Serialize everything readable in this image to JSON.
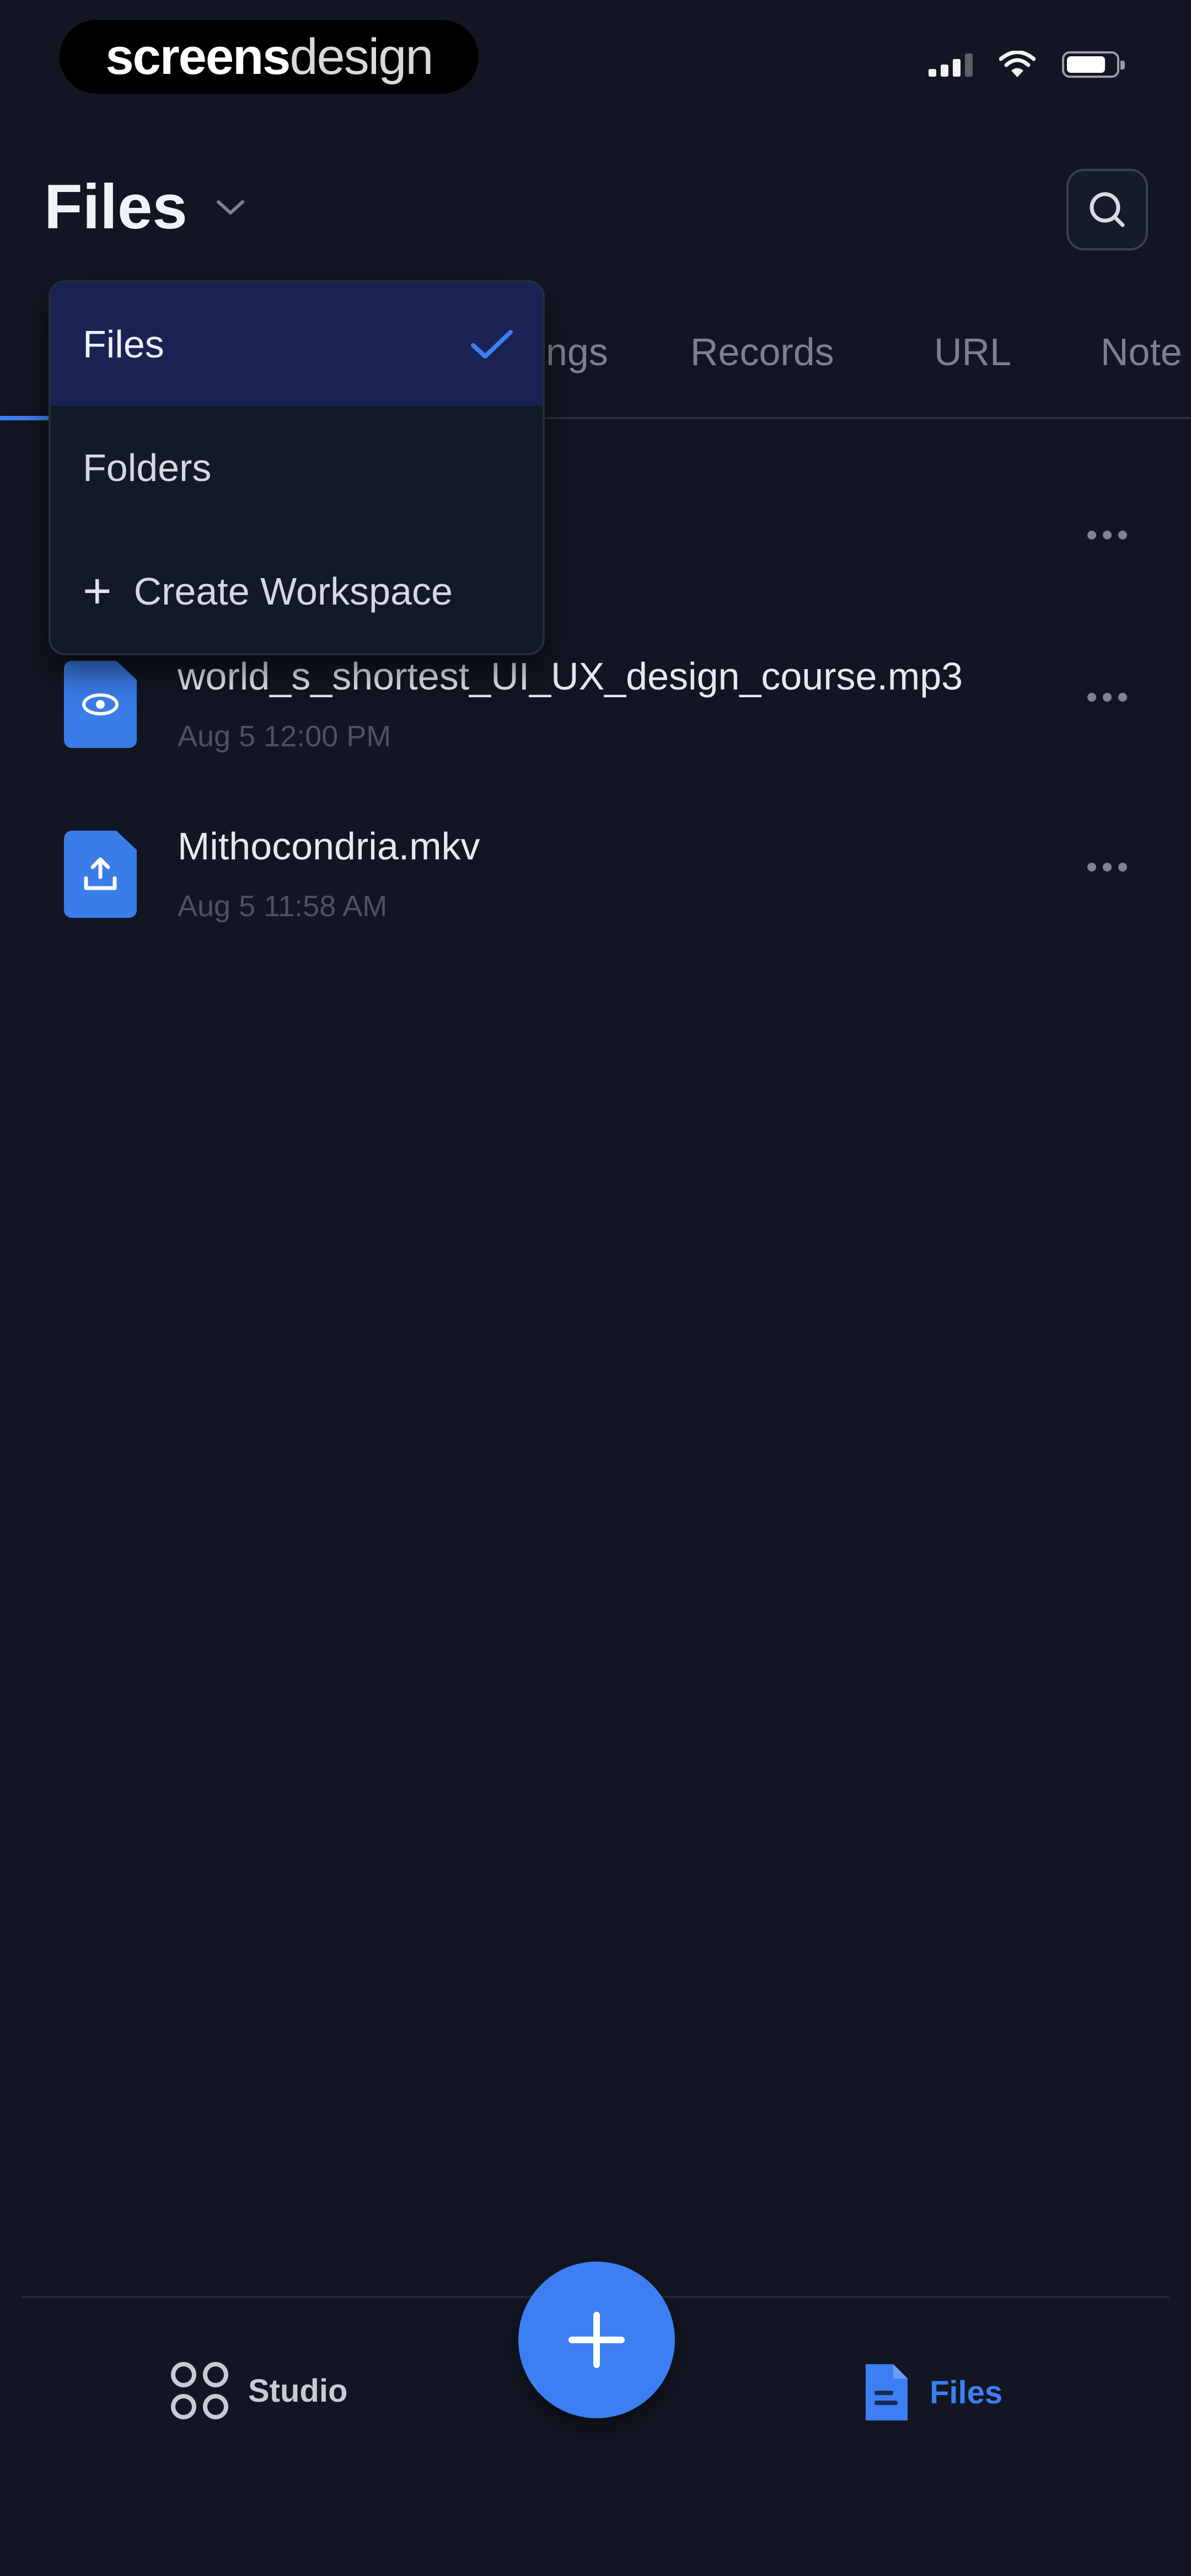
{
  "status_bar": {
    "watermark_bold": "screens",
    "watermark_light": "design",
    "icons": [
      "cellular-signal-icon",
      "wifi-icon",
      "battery-icon"
    ]
  },
  "header": {
    "title": "Files",
    "dropdown_icon": "chevron-down-icon",
    "search_icon": "search-icon"
  },
  "tabs": [
    {
      "label": "ngs"
    },
    {
      "label": "Records"
    },
    {
      "label": "URL"
    },
    {
      "label": "Note"
    }
  ],
  "dropdown": {
    "items": [
      {
        "label": "Files",
        "selected": true
      },
      {
        "label": "Folders",
        "selected": false
      },
      {
        "label": "Create Workspace",
        "selected": false
      }
    ]
  },
  "files": [
    {
      "name": "world_s_shortest_UI_UX_design_course.mp3",
      "date": "Aug 5 12:00 PM",
      "icon": "audio-file-icon"
    },
    {
      "name": "Mithocondria.mkv",
      "date": "Aug 5 11:58 AM",
      "icon": "video-file-icon"
    }
  ],
  "bottom_nav": {
    "studio_label": "Studio",
    "files_label": "Files",
    "fab_icon": "plus-icon"
  },
  "colors": {
    "background": "#121622",
    "accent": "#3d7ff2",
    "selected_item": "#1a2253"
  }
}
